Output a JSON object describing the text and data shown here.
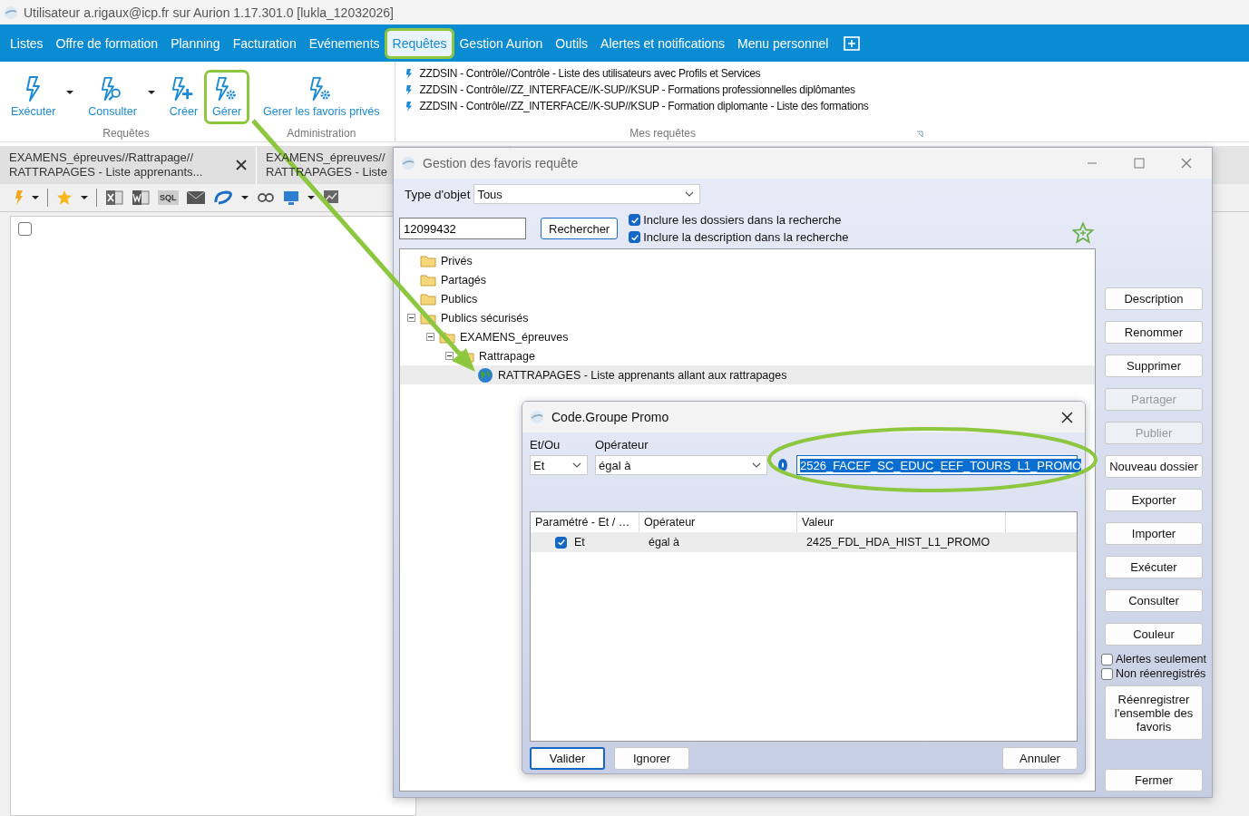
{
  "window": {
    "title": "Utilisateur a.rigaux@icp.fr sur Aurion 1.17.301.0 [lukla_12032026]"
  },
  "menu": [
    {
      "label": "Listes",
      "selected": false,
      "highlighted": false
    },
    {
      "label": "Offre de formation",
      "selected": false,
      "highlighted": false
    },
    {
      "label": "Planning",
      "selected": false,
      "highlighted": false
    },
    {
      "label": "Facturation",
      "selected": false,
      "highlighted": false
    },
    {
      "label": "Evénements",
      "selected": false,
      "highlighted": false
    },
    {
      "label": "Requêtes",
      "selected": true,
      "highlighted": true
    },
    {
      "label": "Gestion Aurion",
      "selected": false,
      "highlighted": false
    },
    {
      "label": "Outils",
      "selected": false,
      "highlighted": false
    },
    {
      "label": "Alertes et notifications",
      "selected": false,
      "highlighted": false
    },
    {
      "label": "Menu personnel",
      "selected": false,
      "highlighted": false
    }
  ],
  "ribbon": {
    "groups": [
      {
        "label": "Requêtes",
        "buttons": [
          {
            "label": "Exécuter",
            "kind": "run",
            "dropdown": true,
            "highlighted": false
          },
          {
            "label": "Consulter",
            "kind": "search",
            "dropdown": true,
            "highlighted": false
          },
          {
            "label": "Créer",
            "kind": "add",
            "dropdown": false,
            "highlighted": false
          },
          {
            "label": "Gérer",
            "kind": "manage",
            "dropdown": false,
            "highlighted": true
          }
        ]
      },
      {
        "label": "Administration",
        "buttons": [
          {
            "label": "Gerer les favoris privés",
            "kind": "manage",
            "dropdown": false,
            "highlighted": false
          }
        ]
      }
    ],
    "queries": {
      "label": "Mes requêtes",
      "items": [
        "ZZDSIN - Contrôle//Contrôle - Liste des utilisateurs avec Profils et Services",
        "ZZDSIN - Contrôle//ZZ_INTERFACE//K-SUP//KSUP - Formations professionnelles diplômantes",
        "ZZDSIN - Contrôle//ZZ_INTERFACE//K-SUP//KSUP - Formation diplomante - Liste des formations"
      ]
    }
  },
  "tabs": [
    {
      "line1": "EXAMENS_épreuves//Rattrapage//",
      "line2": "RATTRAPAGES - Liste apprenants...",
      "closable": true
    },
    {
      "line1": "EXAMENS_épreuves//",
      "line2": "RATTRAPAGES - Liste",
      "closable": false
    }
  ],
  "toolbar": {
    "sql_label": "SQL"
  },
  "list": {
    "select_all_checked": false
  },
  "dialog": {
    "title": "Gestion des favoris requête",
    "type_label": "Type d'objet",
    "type_value": "Tous",
    "search_value": "12099432",
    "search_button": "Rechercher",
    "options": [
      {
        "label": "Inclure les dossiers dans la recherche",
        "checked": true
      },
      {
        "label": "Inclure la description dans la recherche",
        "checked": true
      }
    ],
    "tree": [
      {
        "label": "Privés",
        "kind": "folder",
        "selected": false
      },
      {
        "label": "Partagés",
        "kind": "folder",
        "selected": false
      },
      {
        "label": "Publics",
        "kind": "folder",
        "selected": false
      },
      {
        "label": "Publics sécurisés",
        "kind": "folder",
        "selected": false,
        "expanded": true,
        "children": [
          {
            "label": "EXAMENS_épreuves",
            "kind": "folder",
            "selected": false,
            "expanded": true,
            "children": [
              {
                "label": "Rattrapage",
                "kind": "folder",
                "selected": false,
                "expanded": true,
                "children": [
                  {
                    "label": "RATTRAPAGES - Liste apprenants allant aux rattrapages",
                    "kind": "query",
                    "selected": true
                  }
                ]
              }
            ]
          }
        ]
      }
    ],
    "buttons": [
      {
        "label": "Description",
        "disabled": false
      },
      {
        "label": "Renommer",
        "disabled": false
      },
      {
        "label": "Supprimer",
        "disabled": false
      },
      {
        "label": "Partager",
        "disabled": true
      },
      {
        "label": "Publier",
        "disabled": true
      },
      {
        "label": "Nouveau dossier",
        "disabled": false
      },
      {
        "label": "Exporter",
        "disabled": false
      },
      {
        "label": "Importer",
        "disabled": false
      },
      {
        "label": "Exécuter",
        "disabled": false
      },
      {
        "label": "Consulter",
        "disabled": false
      },
      {
        "label": "Couleur",
        "disabled": false
      }
    ],
    "filters": [
      {
        "label": "Alertes seulement",
        "checked": false
      },
      {
        "label": "Non réenregistrés",
        "checked": false
      }
    ],
    "resave_button": "Réenregistrer l'ensemble des favoris",
    "close_button": "Fermer"
  },
  "subdialog": {
    "title": "Code.Groupe Promo",
    "andor_label": "Et/Ou",
    "andor_value": "Et",
    "operator_label": "Opérateur",
    "operator_value": "égal à",
    "value_checked": true,
    "value": "2526_FACEF_SC_EDUC_EEF_TOURS_L1_PROMO",
    "value_highlighted": true,
    "columns": [
      "Paramétré - Et / …",
      "Opérateur",
      "Valeur"
    ],
    "rows": [
      {
        "checked": true,
        "cells": [
          "Et",
          "égal à",
          "2425_FDL_HDA_HIST_L1_PROMO"
        ]
      }
    ],
    "buttons": [
      {
        "label": "Valider",
        "default": true
      },
      {
        "label": "Ignorer",
        "default": false
      },
      {
        "label": "Annuler",
        "default": false
      }
    ]
  }
}
